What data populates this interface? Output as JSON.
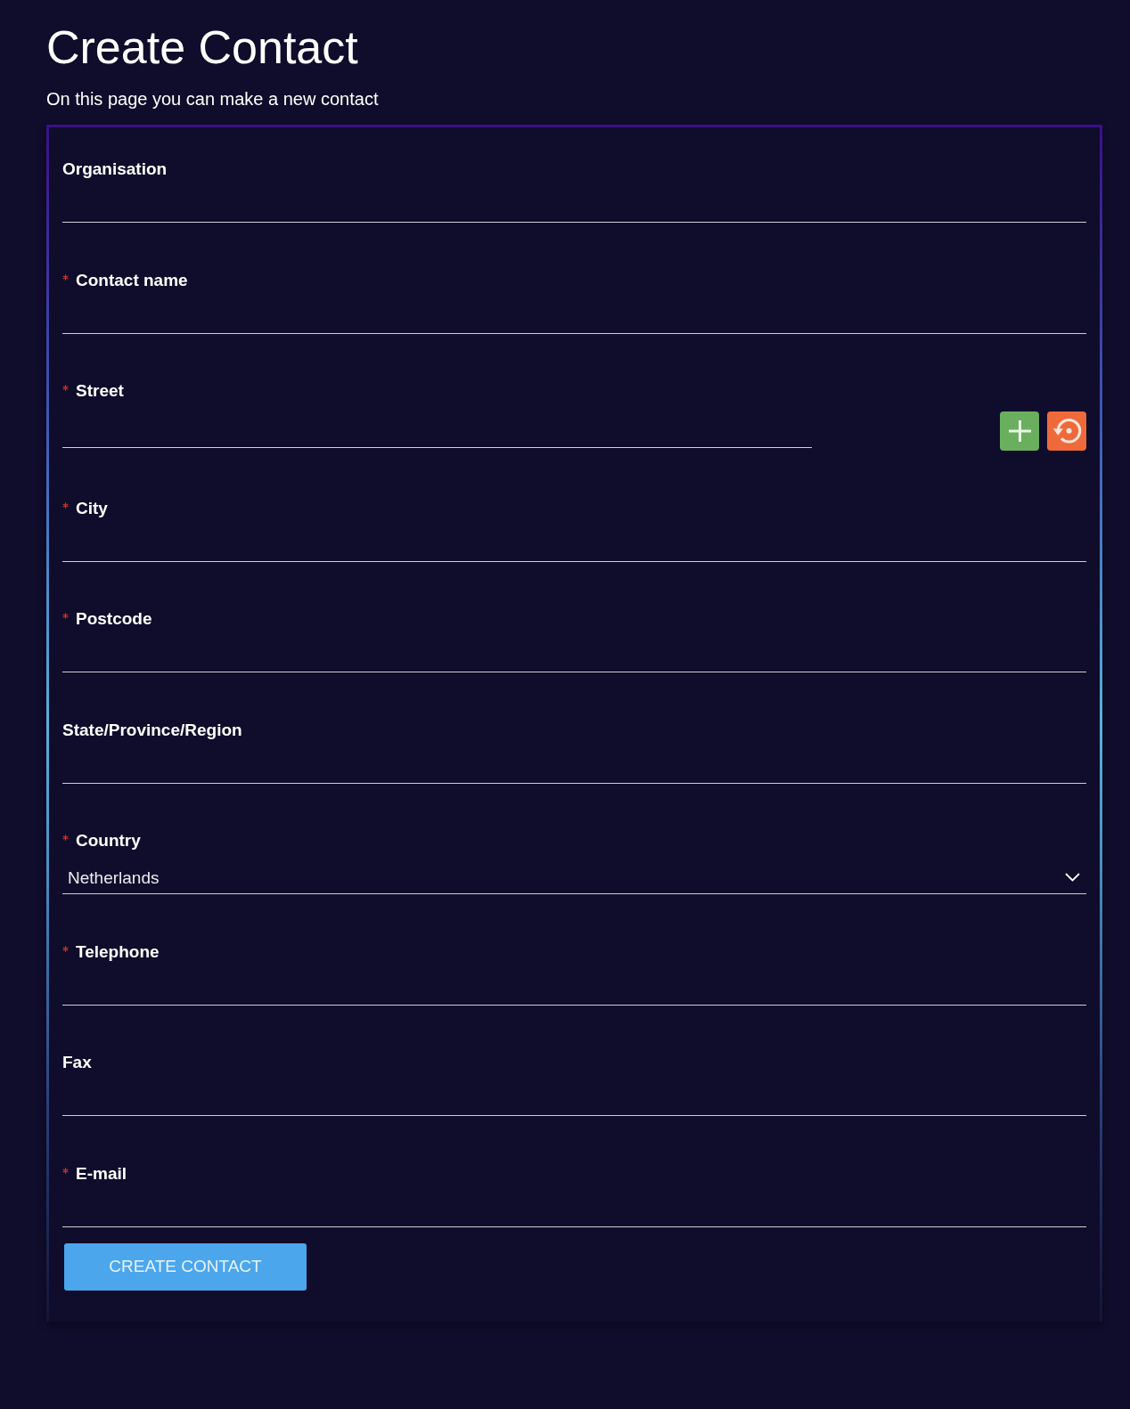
{
  "page": {
    "title": "Create Contact",
    "subtitle": "On this page you can make a new contact"
  },
  "form": {
    "fields": [
      {
        "kind": "text",
        "label": "Organisation",
        "required": false
      },
      {
        "kind": "text",
        "label": "Contact name",
        "required": true
      },
      {
        "kind": "text_actions",
        "label": "Street",
        "required": true,
        "actions": [
          {
            "kind": "add"
          },
          {
            "kind": "reset"
          }
        ]
      },
      {
        "kind": "text",
        "label": "City",
        "required": true
      },
      {
        "kind": "text",
        "label": "Postcode",
        "required": true
      },
      {
        "kind": "text",
        "label": "State/Province/Region",
        "required": false
      },
      {
        "kind": "select",
        "label": "Country",
        "required": true,
        "value": "Netherlands"
      },
      {
        "kind": "text",
        "label": "Telephone",
        "required": true
      },
      {
        "kind": "text",
        "label": "Fax",
        "required": false
      },
      {
        "kind": "text",
        "label": "E-mail",
        "required": true
      }
    ],
    "submit_button": "CREATE CONTACT"
  }
}
